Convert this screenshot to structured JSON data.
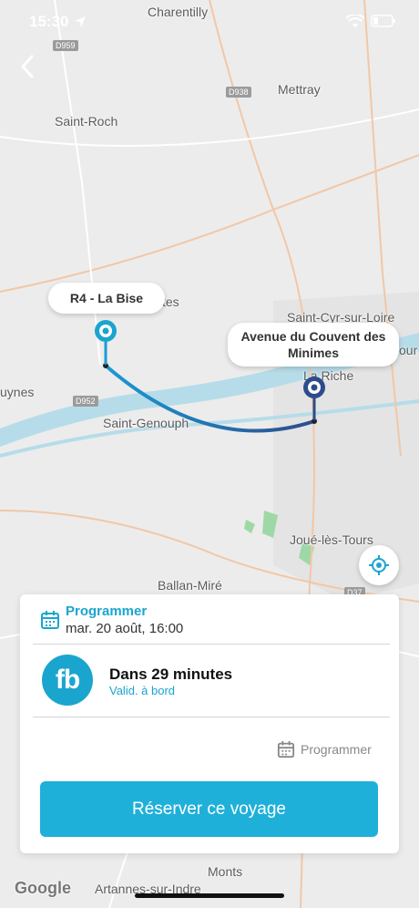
{
  "status_bar": {
    "time": "15:30"
  },
  "map": {
    "places": [
      "Charentilly",
      "Mettray",
      "Saint-Roch",
      "tes",
      "Saint-Cyr-sur-Loire",
      "our",
      "La Riche",
      "uynes",
      "Saint-Genouph",
      "Joué-lès-Tours",
      "Ballan-Miré",
      "Monts",
      "Artannes-sur-Indre"
    ],
    "roads": [
      "D959",
      "D938",
      "D952",
      "D37"
    ],
    "origin_label": "R4 - La Bise",
    "destination_label": "Avenue du Couvent des Minimes",
    "attribution": "Google"
  },
  "card": {
    "schedule_title": "Programmer",
    "schedule_date": "mar. 20 août, 16:00",
    "operator_logo_text": "fb",
    "trip_title": "Dans 29 minutes",
    "trip_subtitle": "Valid. à bord",
    "program_label": "Programmer",
    "reserve_label": "Réserver ce voyage"
  },
  "colors": {
    "accent": "#1aa5cf",
    "route_start": "#1a9ad6",
    "route_end": "#2c4c8c"
  }
}
